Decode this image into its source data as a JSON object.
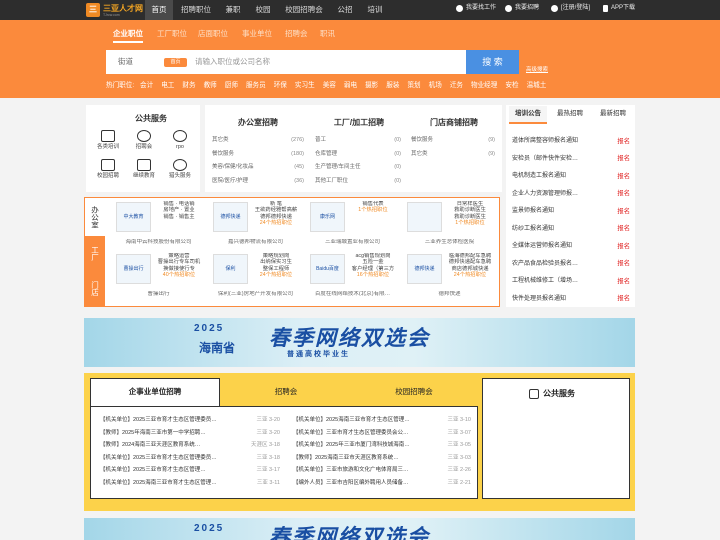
{
  "brand": {
    "logo_mark": "三",
    "name": "三亚人才网",
    "domain": "TJrcw.com"
  },
  "nav": [
    "首页",
    "招聘职位",
    "兼职",
    "校园",
    "校园招聘会",
    "公招",
    "培训"
  ],
  "top_right": {
    "find_job": "我要找工作",
    "hire": "我要招聘",
    "login": "[注册/登陆]",
    "app": "APP下载"
  },
  "search_tabs": [
    "企业职位",
    "工厂职位",
    "店面职位",
    "事业单位",
    "招聘会",
    "职讯"
  ],
  "search": {
    "dropdown": "街道",
    "pill": "首页",
    "placeholder": "请输入职位或公司名称",
    "button": "搜 索",
    "advanced": "高级搜索"
  },
  "hot": {
    "label": "热门职位:",
    "items": [
      "会计",
      "电工",
      "财务",
      "教师",
      "厨师",
      "服务员",
      "环保",
      "实习生",
      "美容",
      "弱电",
      "摄影",
      "服装",
      "策划",
      "机场",
      "迁务",
      "物业经理",
      "安检",
      "温城土"
    ]
  },
  "public_service": {
    "title": "公共服务",
    "items": [
      "各类培训",
      "招聘会",
      "rpo",
      "校园招聘",
      "继续教育",
      "猎头服务"
    ]
  },
  "office": {
    "title": "办公室招聘",
    "rows": [
      {
        "name": "其它类",
        "n": "(276)"
      },
      {
        "name": "餐饮服务",
        "n": "(180)"
      },
      {
        "name": "美容/保健/化妆品",
        "n": "(45)"
      },
      {
        "name": "医院/医疗/护理",
        "n": "(36)"
      }
    ]
  },
  "factory": {
    "title": "工厂/加工招聘",
    "rows": [
      {
        "name": "普工",
        "n": "(0)"
      },
      {
        "name": "仓库管理",
        "n": "(0)"
      },
      {
        "name": "生产管理/车间主任",
        "n": "(0)"
      },
      {
        "name": "其他工厂职位",
        "n": "(0)"
      }
    ]
  },
  "store": {
    "title": "门店商铺招聘",
    "rows": [
      {
        "name": "餐饮服务",
        "n": "(9)"
      },
      {
        "name": "其它类",
        "n": "(9)"
      }
    ]
  },
  "info": {
    "tabs": [
      "培训公告",
      "最热招聘",
      "最新招聘"
    ],
    "rows": [
      "道体所腐整容师报名通知",
      "安检员（邮件快件安检…",
      "电机制造工报名通知",
      "企业人力资源管理师报…",
      "监景师报名通知",
      "纺纱工报名通知",
      "全媒体运营师报名通知",
      "农产品食品检验员报名…",
      "工程机械维修工（增场…",
      "快件处理员报名通知"
    ],
    "action": "报名"
  },
  "companies": {
    "tabs": [
      "办公室",
      "工厂",
      "门店"
    ],
    "top": [
      {
        "logo": "中大教育",
        "lines": [
          "销售 · 电话销",
          "房地产 · 置业",
          "销售 · 销售主"
        ],
        "count": "16个热招职位",
        "name": "海南中云科技股份有限公司"
      },
      {
        "logo": "德邦快递",
        "lines": [
          "新 笔",
          "王欲药经雅帮高薪",
          "德邦德邦快递",
          "",
          "24个热招职位"
        ],
        "count": "",
        "name": "嘉兴德邦物流有限公司"
      },
      {
        "logo": "康乐网",
        "lines": [
          "",
          "销售代表",
          "",
          "1个热招职位"
        ],
        "count": "",
        "name": "三亚瑞城置业有限公司"
      },
      {
        "logo": "",
        "lines": [
          "日常样医生",
          "救助诊断医生",
          "救助诊断医生",
          "1个热招职位"
        ],
        "count": "",
        "name": "三亚养生总体检医院"
      }
    ],
    "bottom": [
      {
        "logo": "曹操出行",
        "lines": [
          "策略运营",
          "曹操出行专车司机",
          "换做接使行专",
          "40个热招职位"
        ],
        "count": "",
        "name": "曹操出行"
      },
      {
        "logo": "保利",
        "lines": [
          "",
          "策略规划岗",
          "出纳保实习生",
          "整保工程师",
          "24个热招职位"
        ],
        "count": "",
        "name": "保利(三亚)房地产开发有限公司"
      },
      {
        "logo": "Baidu百度",
        "lines": [
          "acg销售规划岗",
          "五险一金",
          "客户经理（第三方",
          "16个热招职位"
        ],
        "count": "",
        "name": "百度在线网络技术(北京)有限…"
      },
      {
        "logo": "德邦快递",
        "lines": [
          "临海德邦配车急聘",
          "德邦快递配车急聘",
          "商店德邦城快递",
          "",
          "24个热招职位"
        ],
        "count": "",
        "name": "德邦快递"
      }
    ]
  },
  "banner": {
    "year": "2025",
    "province": "海南省",
    "title": "春季网络双选会",
    "subtitle": "普通高校毕业生"
  },
  "jobs": {
    "tabs": [
      "企事业单位招聘",
      "招聘会",
      "校园招聘会"
    ],
    "public_title": "公共服务",
    "left": [
      {
        "t": "【机关单位】2025三亚市育才生态区管理委员…",
        "p": "三亚",
        "d": "3-20"
      },
      {
        "t": "【教师】2025年海南三亚市第一中学招聘…",
        "p": "三亚",
        "d": "3-20"
      },
      {
        "t": "【教师】2024海南三亚天涯区教育系统…",
        "p": "天涯区",
        "d": "3-18"
      },
      {
        "t": "【机关单位】2025三亚市育才生态区管理委员…",
        "p": "三亚",
        "d": "3-18"
      },
      {
        "t": "【机关单位】2025三亚市育才生态区管理…",
        "p": "三亚",
        "d": "3-17"
      },
      {
        "t": "【机关单位】2025海南三亚市育才生态区管理…",
        "p": "三亚",
        "d": "3-11"
      }
    ],
    "right": [
      {
        "t": "【机关单位】2025海南三亚市育才生态区管理…",
        "p": "三亚",
        "d": "3-10"
      },
      {
        "t": "【机关单位】三亚市育才生态区管理委员会公…",
        "p": "三亚",
        "d": "3-07"
      },
      {
        "t": "【机关单位】2025年三亚市厦门湾科技城海南…",
        "p": "三亚",
        "d": "3-05"
      },
      {
        "t": "【教师】2025海南三亚市天涯区教育系统…",
        "p": "三亚",
        "d": "3-03"
      },
      {
        "t": "【机关单位】三亚市旅游和文化广电体育局三…",
        "p": "三亚",
        "d": "2-26"
      },
      {
        "t": "【编外人员】三亚市吉阳区编外聘用人员储备…",
        "p": "三亚",
        "d": "2-21"
      }
    ]
  }
}
